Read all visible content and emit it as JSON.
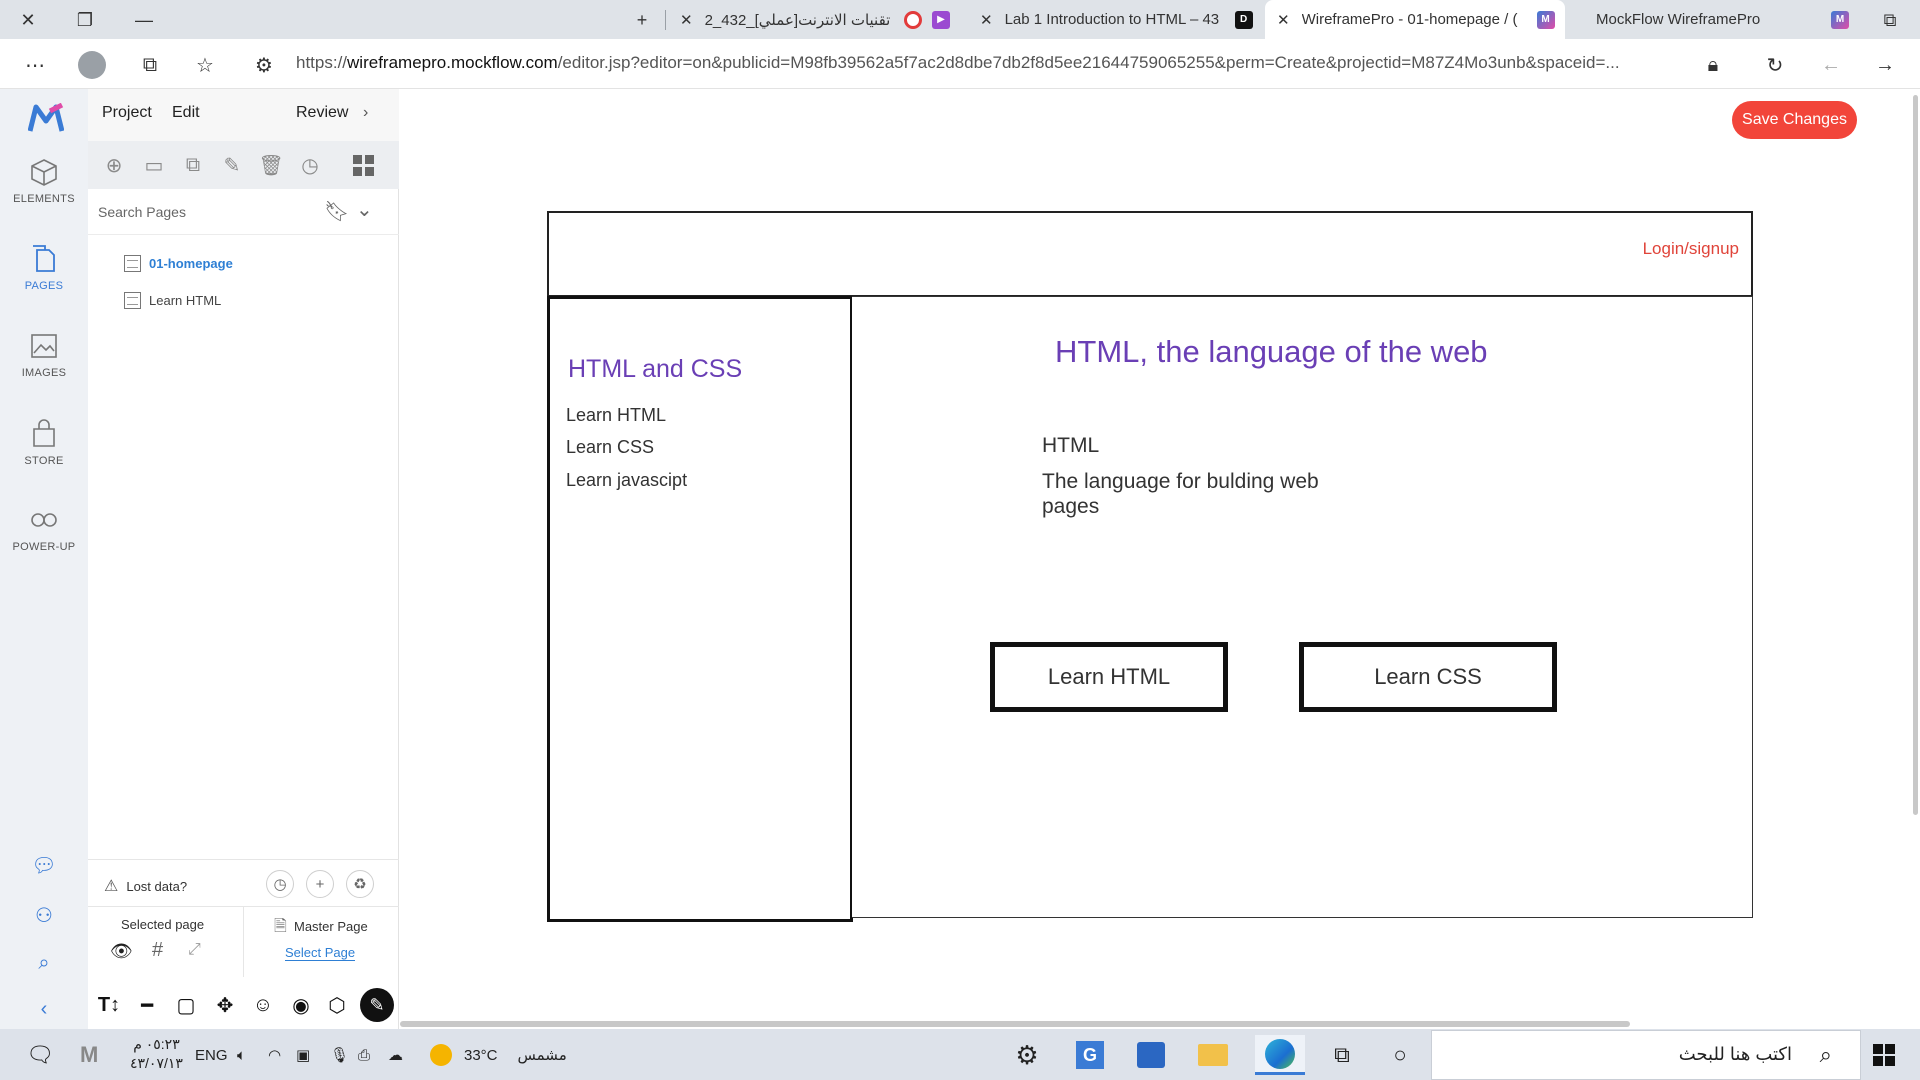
{
  "browser": {
    "tabs": [
      {
        "title": "تقنيات الانترنت[عملي]_432_2",
        "close": "✕"
      },
      {
        "title": "Lab 1 Introduction to HTML – 43",
        "close": "✕"
      },
      {
        "title": "WireframePro - 01-homepage / (",
        "close": "✕"
      },
      {
        "title": "MockFlow WireframePro",
        "close": ""
      }
    ],
    "url_prefix": "https://",
    "url_domain": "wireframepro.mockflow.com",
    "url_rest": "/editor.jsp?editor=on&publicid=M98fb39562a5f7ac2d8dbe7db2f8d5ee21644759065255&perm=Create&projectid=M87Z4Mo3unb&spaceid=..."
  },
  "editor": {
    "menu": {
      "project": "Project",
      "edit": "Edit",
      "review": "Review",
      "chevron": "›"
    },
    "search_placeholder": "Search Pages",
    "pages": [
      {
        "label": "01-homepage"
      },
      {
        "label": "Learn HTML"
      }
    ],
    "rail": {
      "elements": "ELEMENTS",
      "pages": "PAGES",
      "images": "IMAGES",
      "store": "STORE",
      "powerup": "POWER-UP"
    },
    "lost_data": "Lost data?",
    "selected_page": "Selected page",
    "master_page": "Master Page",
    "select_page": "Select Page",
    "save_changes": "Save Changes",
    "accent_color": "#f2453a"
  },
  "wireframe": {
    "login": "Login/signup",
    "side_title": "HTML and CSS",
    "side_links": [
      "Learn HTML",
      "Learn CSS",
      "Learn javascipt"
    ],
    "main_title": "HTML, the language of the web",
    "main_line1": "HTML",
    "main_line2a": "The language for bulding web",
    "main_line2b": "pages",
    "button1": "Learn HTML",
    "button2": "Learn CSS"
  },
  "taskbar": {
    "time": "٠٥:٢٣ م",
    "date": "٤٣/٠٧/١٣",
    "lang": "ENG",
    "weather": "33°C",
    "weather_desc": "مشمس",
    "search_placeholder": "اكتب هنا للبحث"
  }
}
